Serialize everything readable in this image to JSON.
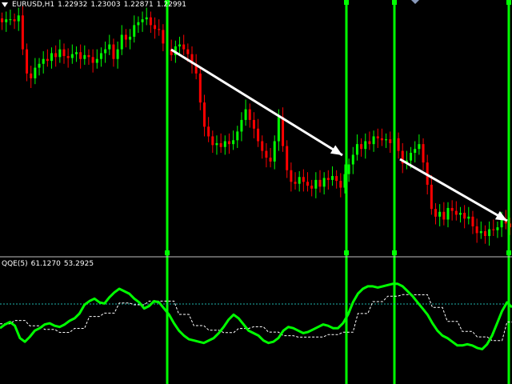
{
  "chart": {
    "symbol": "EURUSD",
    "timeframe": "H1",
    "symbol_timeframe": "EURUSD,H1",
    "ohlc": [
      "1.22932",
      "1.23003",
      "1.22871",
      "1.22991"
    ]
  },
  "indicator": {
    "name": "QQE(5)",
    "value1": "61.1270",
    "value2": "53.2925"
  },
  "icons": {
    "collapse": "triangle-down-icon",
    "shift_marker": "chart-shift-marker-icon"
  },
  "colors": {
    "background": "#000000",
    "bull_candle": "#00ff00",
    "bear_candle": "#ff0000",
    "vline": "#00ff00",
    "qqe_main": "#00ff00",
    "qqe_signal": "#ffffff",
    "level": "#20b2aa",
    "arrow": "#ffffff"
  },
  "chart_data": {
    "type": "candlestick",
    "price_closes": [
      1.2298,
      1.2301,
      1.2301,
      1.2299,
      1.2305,
      1.227,
      1.2245,
      1.224,
      1.2251,
      1.2255,
      1.226,
      1.2258,
      1.2266,
      1.2262,
      1.227,
      1.2263,
      1.2261,
      1.2265,
      1.2267,
      1.226,
      1.2264,
      1.2262,
      1.2256,
      1.226,
      1.2266,
      1.227,
      1.2275,
      1.226,
      1.227,
      1.2285,
      1.228,
      1.2283,
      1.2295,
      1.2298,
      1.2301,
      1.2303,
      1.2295,
      1.2291,
      1.229,
      1.2276,
      1.227,
      1.2264,
      1.2273,
      1.2275,
      1.227,
      1.2265,
      1.2255,
      1.2245,
      1.2215,
      1.219,
      1.218,
      1.2171,
      1.2173,
      1.2169,
      1.2175,
      1.2172,
      1.2176,
      1.2185,
      1.2197,
      1.2208,
      1.2197,
      1.2188,
      1.2175,
      1.2165,
      1.2158,
      1.2154,
      1.2175,
      1.22,
      1.217,
      1.2145,
      1.2133,
      1.2131,
      1.2138,
      1.2133,
      1.2129,
      1.2126,
      1.2135,
      1.2128,
      1.2137,
      1.2135,
      1.2139,
      1.2134,
      1.2127,
      1.2141,
      1.2151,
      1.2161,
      1.2172,
      1.2167,
      1.2175,
      1.2172,
      1.218,
      1.2178,
      1.2176,
      1.2177,
      1.2173,
      1.2178,
      1.2165,
      1.2152,
      1.2155,
      1.2163,
      1.2167,
      1.2172,
      1.2153,
      1.213,
      1.2105,
      1.2097,
      1.2102,
      1.2094,
      1.2106,
      1.2103,
      1.2099,
      1.2101,
      1.2095,
      1.2097,
      1.2087,
      1.208,
      1.2082,
      1.2077,
      1.2084,
      1.2083,
      1.2086,
      1.2094,
      1.209,
      1.2086
    ],
    "qqe_main": [
      44,
      47,
      49,
      46,
      36,
      33,
      37,
      42,
      44,
      47,
      48,
      46,
      45,
      47,
      50,
      52,
      56,
      63,
      66,
      68,
      65,
      64,
      69,
      73,
      76,
      74,
      72,
      68,
      65,
      60,
      62,
      66,
      65,
      60,
      55,
      48,
      42,
      38,
      35,
      34,
      33,
      32,
      34,
      36,
      40,
      45,
      51,
      55,
      52,
      47,
      42,
      40,
      38,
      34,
      32,
      33,
      36,
      42,
      45,
      44,
      42,
      40,
      41,
      43,
      45,
      47,
      46,
      44,
      44,
      48,
      55,
      65,
      72,
      76,
      78,
      78,
      77,
      78,
      79,
      80,
      80,
      78,
      74,
      70,
      65,
      60,
      55,
      48,
      42,
      38,
      36,
      33,
      30,
      30,
      31,
      30,
      28,
      27,
      31,
      38,
      48,
      58,
      65,
      61
    ]
  }
}
